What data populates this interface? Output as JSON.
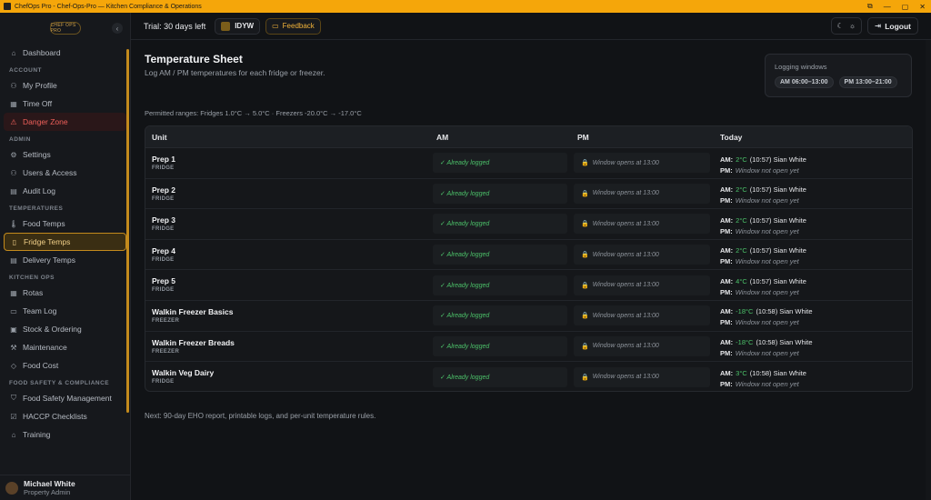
{
  "window": {
    "title": "ChefOps Pro - Chef-Ops-Pro — Kitchen Compliance & Operations"
  },
  "brand": {
    "logo_text": "CHEF OPS PRO"
  },
  "sidebar": {
    "dashboard": "Dashboard",
    "sections": {
      "account": "ACCOUNT",
      "admin": "ADMIN",
      "temperatures": "TEMPERATURES",
      "kitchen_ops": "KITCHEN OPS",
      "food_safety": "FOOD SAFETY & COMPLIANCE"
    },
    "items": {
      "my_profile": "My Profile",
      "time_off": "Time Off",
      "danger_zone": "Danger Zone",
      "settings": "Settings",
      "users_access": "Users & Access",
      "audit_log": "Audit Log",
      "food_temps": "Food Temps",
      "fridge_temps": "Fridge Temps",
      "delivery_temps": "Delivery Temps",
      "rotas": "Rotas",
      "team_log": "Team Log",
      "stock_ordering": "Stock & Ordering",
      "maintenance": "Maintenance",
      "food_cost": "Food Cost",
      "food_safety_mgmt": "Food Safety Management",
      "haccp": "HACCP Checklists",
      "training": "Training"
    },
    "user": {
      "name": "Michael White",
      "role": "Property Admin"
    }
  },
  "topbar": {
    "trial": "Trial: 30 days left",
    "org": "IDYW",
    "feedback": "Feedback",
    "logout": "Logout"
  },
  "page": {
    "title": "Temperature Sheet",
    "subtitle": "Log AM / PM temperatures for each fridge or freezer.",
    "logging_label": "Logging windows",
    "am_window": "AM 06:00–13:00",
    "pm_window": "PM 13:00–21:00",
    "ranges": "Permitted ranges: Fridges 1.0°C → 5.0°C · Freezers -20.0°C → -17.0°C",
    "footer": "Next: 90-day EHO report, printable logs, and per-unit temperature rules."
  },
  "table": {
    "headers": {
      "unit": "Unit",
      "am": "AM",
      "pm": "PM",
      "today": "Today"
    },
    "am_status": "✓ Already logged",
    "pm_status": "Window opens at 13:00",
    "am_label": "AM:",
    "pm_label": "PM:",
    "pm_today": "Window not open yet",
    "rows": [
      {
        "name": "Prep 1",
        "type": "FRIDGE",
        "temp": "2°C",
        "time": "(10:57)",
        "by": "Sian White"
      },
      {
        "name": "Prep 2",
        "type": "FRIDGE",
        "temp": "2°C",
        "time": "(10:57)",
        "by": "Sian White"
      },
      {
        "name": "Prep 3",
        "type": "FRIDGE",
        "temp": "2°C",
        "time": "(10:57)",
        "by": "Sian White"
      },
      {
        "name": "Prep 4",
        "type": "FRIDGE",
        "temp": "2°C",
        "time": "(10:57)",
        "by": "Sian White"
      },
      {
        "name": "Prep 5",
        "type": "FRIDGE",
        "temp": "4°C",
        "time": "(10:57)",
        "by": "Sian White"
      },
      {
        "name": "Walkin Freezer Basics",
        "type": "FREEZER",
        "temp": "-18°C",
        "time": "(10:58)",
        "by": "Sian White"
      },
      {
        "name": "Walkin Freezer Breads",
        "type": "FREEZER",
        "temp": "-18°C",
        "time": "(10:58)",
        "by": "Sian White"
      },
      {
        "name": "Walkin Veg Dairy",
        "type": "FRIDGE",
        "temp": "3°C",
        "time": "(10:58)",
        "by": "Sian White"
      }
    ]
  }
}
